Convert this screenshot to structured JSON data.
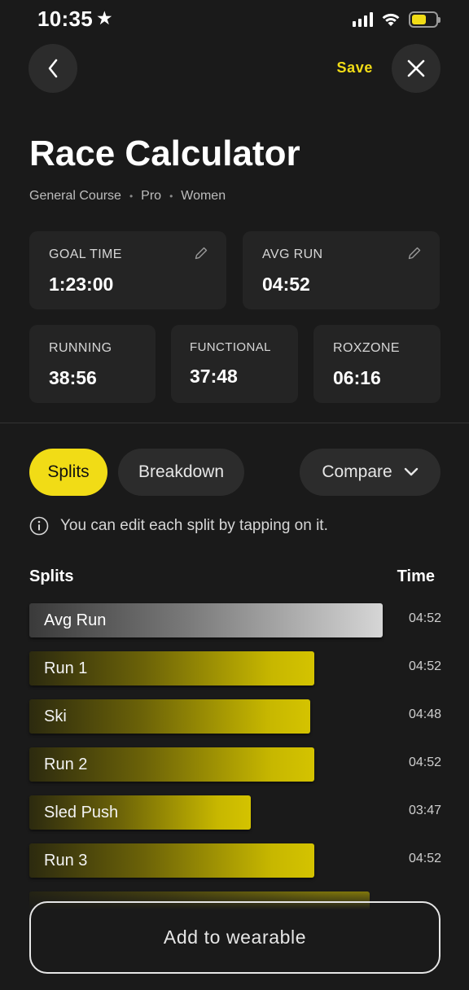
{
  "status_bar": {
    "time": "10:35",
    "star": "★",
    "battery_color": "#f1dc16"
  },
  "header": {
    "back_icon": "chevron-left-icon",
    "save_label": "Save",
    "close_icon": "close-icon",
    "accent_color": "#f1dc16"
  },
  "page": {
    "title": "Race Calculator",
    "subtitle": {
      "course": "General Course",
      "level": "Pro",
      "category": "Women"
    }
  },
  "stats": {
    "goal_time": {
      "label": "GOAL TIME",
      "value": "1:23:00",
      "icon": "pencil-icon"
    },
    "avg_run": {
      "label": "AVG RUN",
      "value": "04:52",
      "icon": "pencil-icon"
    },
    "running": {
      "label": "RUNNING",
      "value": "38:56"
    },
    "functional": {
      "label": "FUNCTIONAL",
      "value": "37:48"
    },
    "roxzone": {
      "label": "ROXZONE",
      "value": "06:16"
    }
  },
  "tabs": {
    "splits": "Splits",
    "breakdown": "Breakdown",
    "compare": "Compare",
    "active": "Splits"
  },
  "info": {
    "icon": "info-icon",
    "text": "You can edit each split by tapping on it."
  },
  "table": {
    "col_splits": "Splits",
    "col_time": "Time",
    "rows": [
      {
        "label": "Avg Run",
        "time": "04:52",
        "style": "grey"
      },
      {
        "label": "Run 1",
        "time": "04:52",
        "style": "yellow"
      },
      {
        "label": "Ski",
        "time": "04:48",
        "style": "yellow"
      },
      {
        "label": "Run 2",
        "time": "04:52",
        "style": "yellow"
      },
      {
        "label": "Sled Push",
        "time": "03:47",
        "style": "yellow"
      },
      {
        "label": "Run 3",
        "time": "04:52",
        "style": "yellow"
      }
    ]
  },
  "footer": {
    "button_label": "Add to wearable"
  }
}
